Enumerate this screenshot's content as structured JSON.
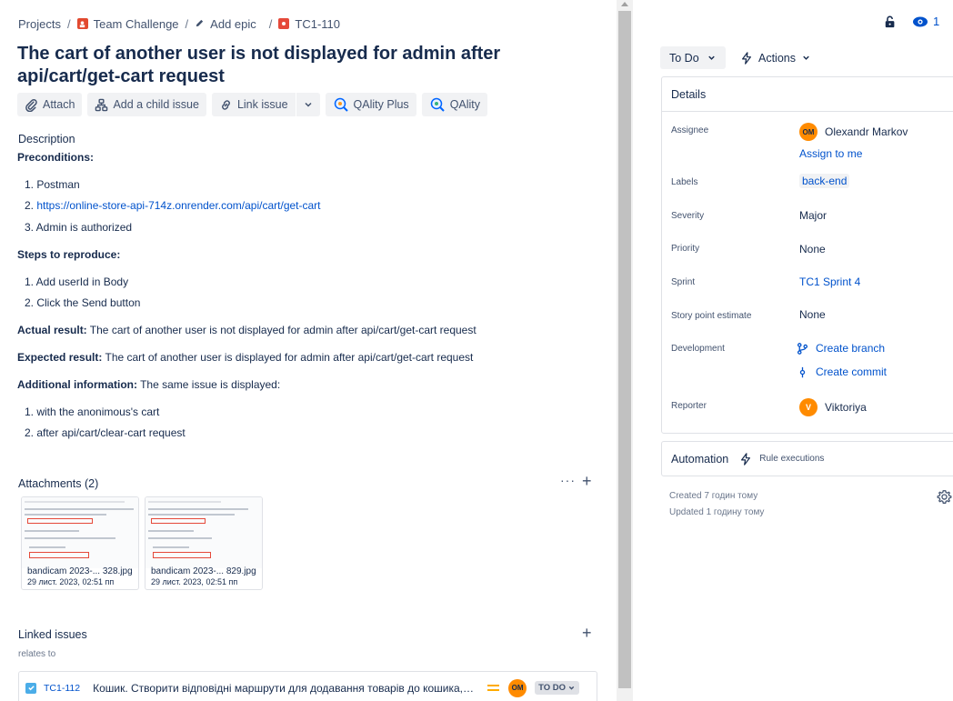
{
  "breadcrumb": {
    "projects": "Projects",
    "sep": "/",
    "project": "Team Challenge",
    "epic": "Add epic",
    "issue_key": "TC1-110"
  },
  "issue": {
    "title": "The cart of another user is not displayed for admin after api/cart/get-cart request"
  },
  "toolbar": {
    "attach": "Attach",
    "add_child": "Add a child issue",
    "link_issue": "Link issue",
    "qality_plus": "QAlity Plus",
    "qality": "QAlity"
  },
  "description": {
    "label": "Description",
    "preconditions_h": "Preconditions:",
    "preconditions": [
      "1. Postman",
      "2. ",
      "3. Admin is authorized"
    ],
    "precondition_link": "https://online-store-api-714z.onrender.com/api/cart/get-cart",
    "steps_h": "Steps to reproduce:",
    "steps": [
      "1. Add userId in Body",
      "2. Click the Send button"
    ],
    "actual_h": "Actual result:",
    "actual": " The cart of another user is not displayed for admin after api/cart/get-cart request",
    "expected_h": "Expected result:",
    "expected": " The cart of another user is displayed for admin after api/cart/get-cart request",
    "additional_h": "Additional information:",
    "additional": " The same issue is displayed:",
    "additional_items": [
      "1. with the anonimous's cart",
      "2. after api/cart/clear-cart request"
    ]
  },
  "attachments": {
    "title": "Attachments (2)",
    "more": "···",
    "plus": "+",
    "items": [
      {
        "name": "bandicam 2023-... 328.jpg",
        "date": "29 лист. 2023, 02:51 пп"
      },
      {
        "name": "bandicam 2023-... 829.jpg",
        "date": "29 лист. 2023, 02:51 пп"
      }
    ]
  },
  "linked": {
    "title": "Linked issues",
    "plus": "+",
    "relates": "relates to",
    "item": {
      "key": "TC1-112",
      "summary": "Кошик. Створити відповідні маршрути для додавання товарів до кошика, пе...",
      "avatar": "OM",
      "status": "TO DO"
    }
  },
  "header_right": {
    "watch_count": "1",
    "status": "To Do",
    "actions": "Actions"
  },
  "details": {
    "title": "Details",
    "assignee_label": "Assignee",
    "assignee": "Olexandr Markov",
    "assignee_initials": "OM",
    "assign_to_me": "Assign to me",
    "labels_label": "Labels",
    "labels": "back-end",
    "severity_label": "Severity",
    "severity": "Major",
    "priority_label": "Priority",
    "priority": "None",
    "sprint_label": "Sprint",
    "sprint": "TC1 Sprint 4",
    "story_label": "Story point estimate",
    "story": "None",
    "development_label": "Development",
    "create_branch": "Create branch",
    "create_commit": "Create commit",
    "reporter_label": "Reporter",
    "reporter": "Viktoriya",
    "reporter_initials": "V"
  },
  "automation": {
    "title": "Automation",
    "rule": "Rule executions"
  },
  "meta": {
    "created": "Created 7 годин тому",
    "updated": "Updated 1 годину тому"
  },
  "colors": {
    "link": "#0052cc",
    "text": "#172b4d",
    "avatar": "#ff8b00",
    "bug": "#e5493a",
    "subtle_bg": "#f1f2f4"
  },
  "icons": [
    "paperclip-icon",
    "child-issue-icon",
    "link-icon",
    "chevron-down-icon",
    "qality-icon",
    "lock-icon",
    "eye-icon",
    "lightning-icon",
    "branch-icon",
    "commit-icon",
    "gear-icon",
    "checkbox-icon",
    "priority-medium-icon"
  ]
}
